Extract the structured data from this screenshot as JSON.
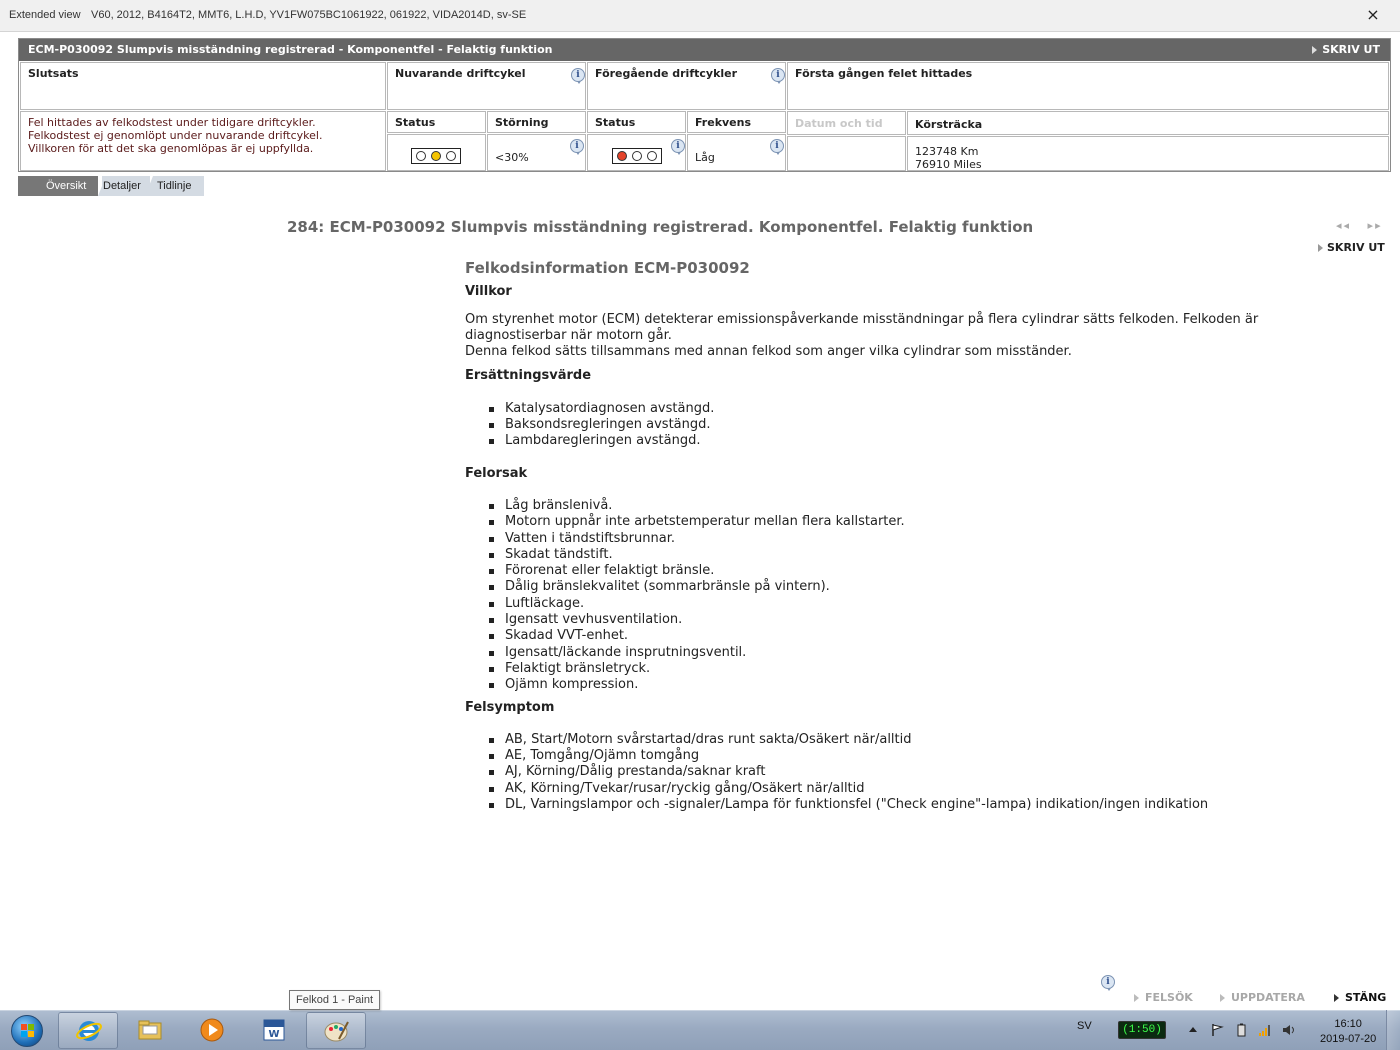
{
  "window": {
    "mode_label": "Extended view",
    "context": "V60, 2012, B4164T2, MMT6, L.H.D, YV1FW075BC1061922, 061922, VIDA2014D, sv-SE",
    "close_glyph": "×"
  },
  "panel": {
    "title": "ECM-P030092 Slumpvis misständning registrerad - Komponentfel - Felaktig funktion",
    "print_label": "SKRIV UT",
    "slutsats": {
      "header": "Slutsats",
      "lines": [
        "Fel hittades av felkodstest under tidigare driftcykler.",
        "Felkodstest ej genomlöpt under nuvarande driftcykel.",
        "Villkoren för att det ska genomlöpas är ej uppfyllda."
      ]
    },
    "current_cycle": {
      "header": "Nuvarande driftcykel",
      "status_label": "Status",
      "disturbance_label": "Störning",
      "disturbance_value": "<30%",
      "lights": [
        "#ffffff",
        "#f5c400",
        "#ffffff"
      ]
    },
    "previous_cycles": {
      "header": "Föregående driftcykler",
      "status_label": "Status",
      "frequency_label": "Frekvens",
      "frequency_value": "Låg",
      "lights": [
        "#e4432a",
        "#ffffff",
        "#ffffff"
      ]
    },
    "first_found": {
      "header": "Första gången felet hittades",
      "datetime_label": "Datum och tid",
      "mileage_label": "Körsträcka",
      "mileage_km": "123748 Km",
      "mileage_miles": "76910 Miles"
    }
  },
  "tabs": [
    {
      "label": "Översikt",
      "active": true
    },
    {
      "label": "Detaljer",
      "active": false
    },
    {
      "label": "Tidlinje",
      "active": false
    }
  ],
  "doc": {
    "title": "284: ECM-P030092 Slumpvis misständning registrerad. Komponentfel. Felaktig funktion",
    "nav_prev": "◂◂",
    "nav_next": "▸▸",
    "print_label": "SKRIV UT",
    "info_heading": "Felkodsinformation ECM-P030092",
    "villkor_heading": "Villkor",
    "villkor_p1": "Om styrenhet motor (ECM) detekterar emissionspåverkande misständningar på flera cylindrar sätts felkoden. Felkoden är diagnostiserbar när motorn går.",
    "villkor_p2": "Denna felkod sätts tillsammans med annan felkod som anger vilka cylindrar som misständer.",
    "replacement_heading": "Ersättningsvärde",
    "replacement_items": [
      "Katalysatordiagnosen avstängd.",
      "Baksondsregleringen avstängd.",
      "Lambdaregleringen avstängd."
    ],
    "cause_heading": "Felorsak",
    "cause_items": [
      "Låg bränslenivå.",
      "Motorn uppnår inte arbetstemperatur mellan flera kallstarter.",
      "Vatten i tändstiftsbrunnar.",
      "Skadat tändstift.",
      "Förorenat eller felaktigt bränsle.",
      "Dålig bränslekvalitet (sommarbränsle på vintern).",
      "Luftläckage.",
      "Igensatt vevhusventilation.",
      "Skadad VVT-enhet.",
      "Igensatt/läckande insprutningsventil.",
      "Felaktigt bränsletryck.",
      "Ojämn kompression."
    ],
    "symptom_heading": "Felsymptom",
    "symptom_items": [
      "AB, Start/Motorn svårstartad/dras runt sakta/Osäkert när/alltid",
      "AE, Tomgång/Ojämn tomgång",
      "AJ, Körning/Dålig prestanda/saknar kraft",
      "AK, Körning/Tvekar/rusar/ryckig gång/Osäkert när/alltid",
      "DL, Varningslampor och -signaler/Lampa för funktionsfel (\"Check engine\"-lampa) indikation/ingen indikation"
    ]
  },
  "bottom": {
    "info_glyph": "i",
    "felsok": "FELSÖK",
    "uppdatera": "UPPDATERA",
    "stang": "STÄNG"
  },
  "tooltip": "Felkod 1 - Paint",
  "taskbar": {
    "lang": "SV",
    "battery": "(1:50)",
    "time": "16:10",
    "date": "2019-07-20"
  }
}
